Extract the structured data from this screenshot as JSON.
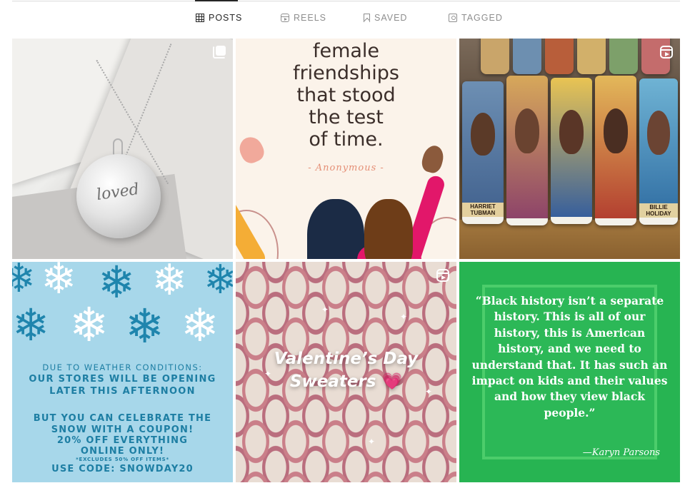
{
  "tabs": [
    {
      "label": "POSTS",
      "icon": "grid-icon",
      "active": true
    },
    {
      "label": "REELS",
      "icon": "reels-icon",
      "active": false
    },
    {
      "label": "SAVED",
      "icon": "bookmark-icon",
      "active": false
    },
    {
      "label": "TAGGED",
      "icon": "tag-icon",
      "active": false
    }
  ],
  "posts": [
    {
      "type": "carousel",
      "badge": "multiple-photos-icon",
      "content": {
        "engraving": "loved"
      }
    },
    {
      "type": "image",
      "content": {
        "lines": [
          "female",
          "friendships",
          "that stood",
          "the test",
          "of time."
        ],
        "author": "- Anonymous -"
      }
    },
    {
      "type": "reel",
      "badge": "reels-icon",
      "content": {
        "labels": [
          "HARRIET TUBMAN",
          "BILLIE HOLIDAY"
        ]
      }
    },
    {
      "type": "image",
      "content": {
        "line1": "DUE TO WEATHER CONDITIONS:",
        "line2": "OUR STORES WILL BE OPENING",
        "line3": "LATER THIS AFTERNOON",
        "line4": "BUT YOU CAN CELEBRATE THE",
        "line5": "SNOW WITH A COUPON!",
        "line6": "20% OFF EVERYTHING",
        "line7": "ONLINE ONLY!",
        "line8": "*EXCLUDES 50% OFF ITEMS*",
        "line9": "USE CODE: SNOWDAY20"
      }
    },
    {
      "type": "reel",
      "badge": "reels-icon",
      "content": {
        "line1": "Valentine’s Day",
        "line2": "Sweaters",
        "emoji": "💗"
      }
    },
    {
      "type": "image",
      "content": {
        "quote": "“Black history isn’t a separate history. This is all of our history, this is American history, and we need to understand that. It has such an impact on kids and their values and how they view black people.”",
        "signature": "—Karyn Parsons"
      }
    }
  ],
  "colors": {
    "tab_active": "#262626",
    "tab_inactive": "#8e8e8e",
    "divider": "#dbdbdb",
    "snow_bg": "#a7d7ea",
    "snow_text": "#1d7ea3",
    "quote_bg": "#27b452",
    "friend_bg": "#fbf3ea"
  }
}
